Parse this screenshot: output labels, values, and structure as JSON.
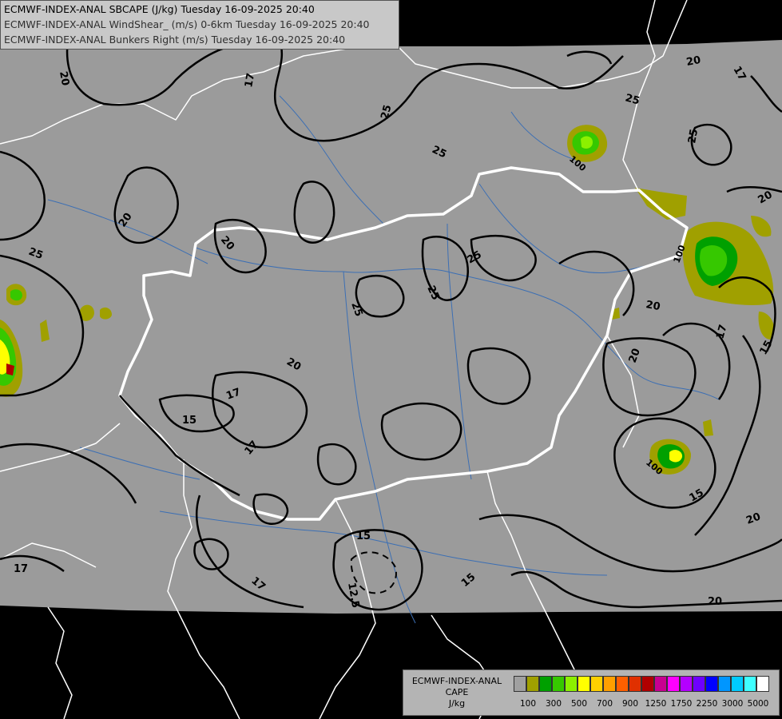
{
  "header": {
    "line1": "ECMWF-INDEX-ANAL SBCAPE (J/kg) Tuesday 16-09-2025 20:40",
    "line2": "ECMWF-INDEX-ANAL WindShear_ (m/s) 0-6km Tuesday 16-09-2025 20:40",
    "line3": "ECMWF-INDEX-ANAL Bunkers Right (m/s) Tuesday 16-09-2025 20:40"
  },
  "legend": {
    "title_line1": "ECMWF-INDEX-ANAL",
    "title_line2": "CAPE",
    "title_line3": "J/kg",
    "colors": [
      "#a0a0a0",
      "#a0a000",
      "#00a000",
      "#36c800",
      "#8cf000",
      "#ffff00",
      "#ffd000",
      "#ffa000",
      "#ff6000",
      "#e03000",
      "#b00000",
      "#c80090",
      "#ff00ff",
      "#b400ff",
      "#6e00ff",
      "#0000ff",
      "#0096ff",
      "#00ccff",
      "#40ffff",
      "#ffffff"
    ],
    "ticks": [
      "100",
      "300",
      "500",
      "700",
      "900",
      "1250",
      "1750",
      "2250",
      "3000",
      "5000"
    ]
  },
  "contour_labels": {
    "c1": "20",
    "c2": "17",
    "c3": "25",
    "c4": "25",
    "c5": "20",
    "c6": "17",
    "c7": "25",
    "c8": "25",
    "c9": "20",
    "c10": "25",
    "c11": "25",
    "c12": "25",
    "c13": "20",
    "c14": "20",
    "c15": "17",
    "c16": "15",
    "c17": "15",
    "c18": "17",
    "c19": "20",
    "c20": "17",
    "c21": "15",
    "c22": "12.5",
    "c23": "17",
    "c24": "15",
    "c25": "15",
    "c26": "20",
    "c27": "20",
    "c28": "20",
    "c29": "17",
    "c30": "15",
    "c31": "20",
    "c32": "25",
    "c33": "20",
    "c34": "100",
    "c35": "100",
    "c36": "100",
    "c37": "20"
  }
}
